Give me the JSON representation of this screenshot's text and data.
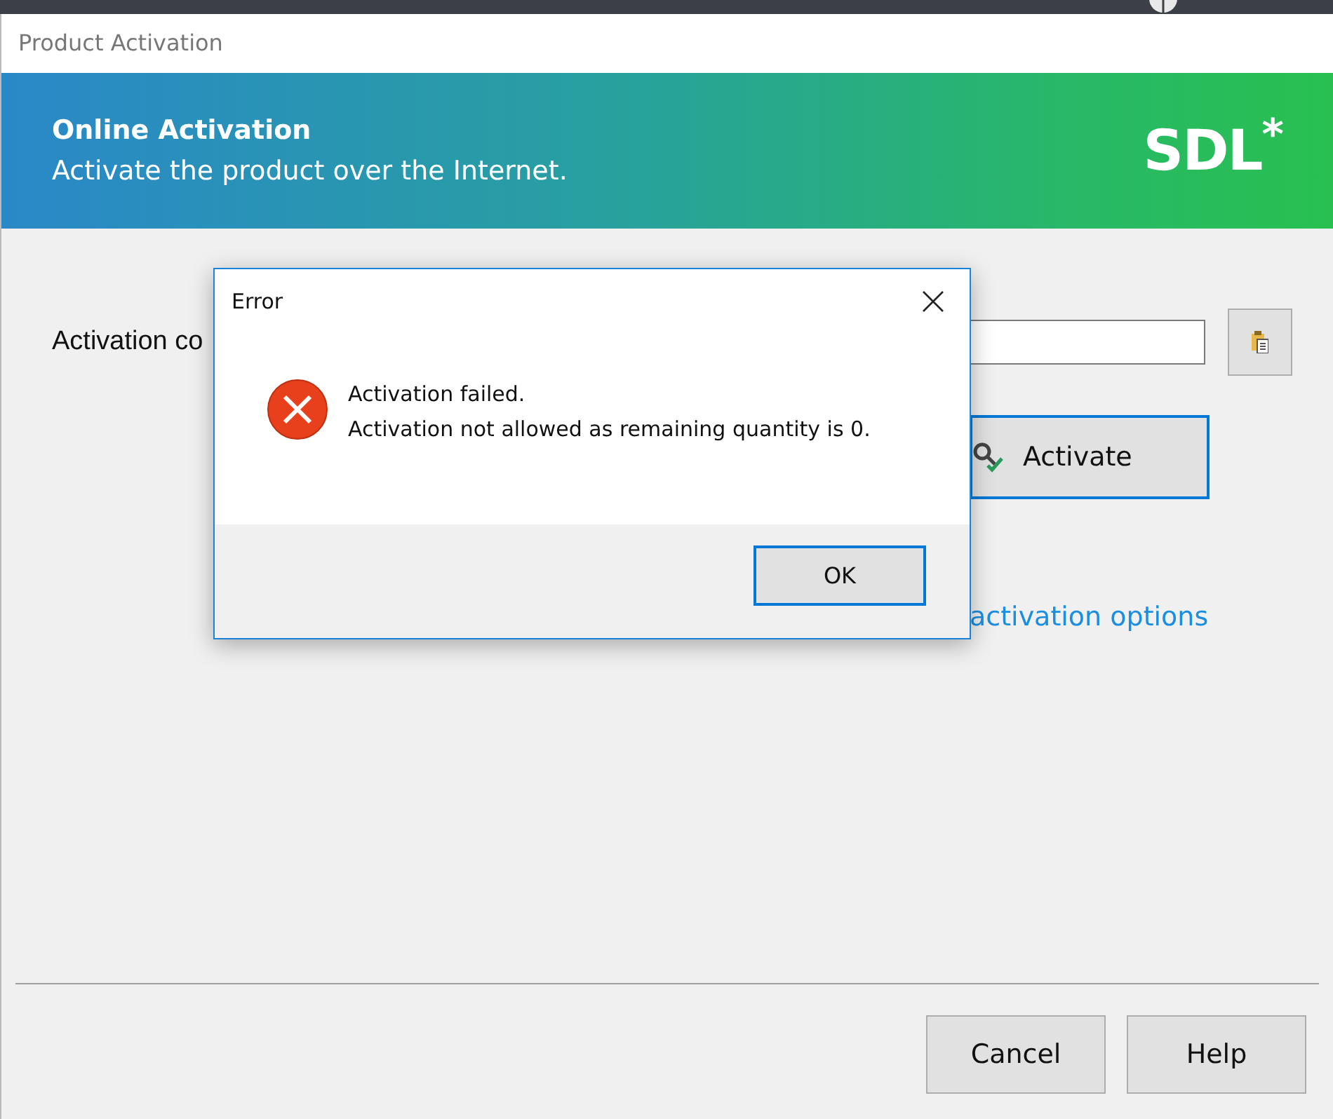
{
  "window": {
    "title": "Product Activation"
  },
  "banner": {
    "title": "Online Activation",
    "subtitle": "Activate the product over the Internet.",
    "logo": "SDL$^{*}$"
  },
  "form": {
    "label": "Activation co",
    "activate_button": {
      "label": "Activate",
      "focused": true
    },
    "link": "activation options"
  },
  "footer_buttons": [
    {
      "label": "Cancel",
      "focused": false
    },
    {
      "label": "Help",
      "focused": false
    }
  ],
  "dialog": {
    "title": "Error",
    "messages": [
      "Activation failed.",
      "Activation not allowed as remaining quantity is 0."
    ],
    "ok_button": {
      "label": "OK",
      "focused": true
    }
  }
}
